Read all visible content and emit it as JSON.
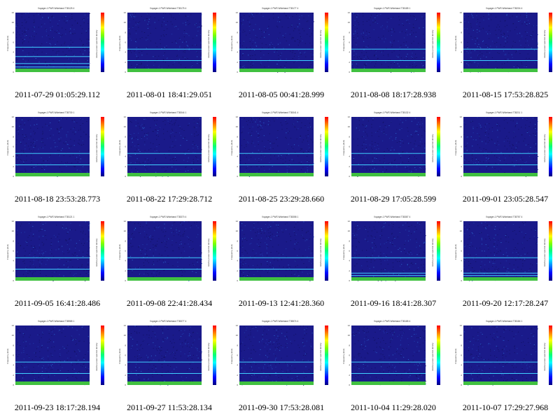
{
  "gallery": {
    "items": [
      {
        "caption": "2011-07-29 01:05:29.112",
        "plot_title": "Voyager-1 PWS Wideband T35125 4",
        "lines": [
          5.1,
          3.2,
          1.8,
          1.1
        ]
      },
      {
        "caption": "2011-08-01 18:41:29.051",
        "plot_title": "Voyager-1 PWS Wideband T35175 4",
        "lines": [
          4.7,
          2.4
        ]
      },
      {
        "caption": "2011-08-05 00:41:28.999",
        "plot_title": "Voyager-1 PWS Wideband T35177 4",
        "lines": [
          4.7,
          2.4
        ]
      },
      {
        "caption": "2011-08-08 18:17:28.938",
        "plot_title": "Voyager-1 PWS Wideband T35185 1",
        "lines": [
          4.7,
          2.4
        ]
      },
      {
        "caption": "2011-08-15 17:53:28.825",
        "plot_title": "Voyager-1 PWS Wideband T35204 4",
        "lines": [
          4.7,
          2.4
        ]
      },
      {
        "caption": "2011-08-18 23:53:28.773",
        "plot_title": "Voyager-1 PWS Wideband T35730 1",
        "lines": [
          4.7,
          2.4
        ]
      },
      {
        "caption": "2011-08-22 17:29:28.712",
        "plot_title": "Voyager-1 PWS Wideband T35344 1",
        "lines": [
          4.7,
          2.4
        ]
      },
      {
        "caption": "2011-08-25 23:29:28.660",
        "plot_title": "Voyager-1 PWS Wideband T35341 4",
        "lines": [
          4.7,
          2.4
        ]
      },
      {
        "caption": "2011-08-29 17:05:28.599",
        "plot_title": "Voyager-1 PWS Wideband T35132 4",
        "lines": [
          4.7,
          2.4
        ]
      },
      {
        "caption": "2011-09-01 23:05:28.547",
        "plot_title": "Voyager-1 PWS Wideband T35211 1",
        "lines": [
          4.7,
          2.4
        ]
      },
      {
        "caption": "2011-09-05 16:41:28.486",
        "plot_title": "Voyager-1 PWS Wideband T35121 1",
        "lines": [
          4.7,
          2.4
        ]
      },
      {
        "caption": "2011-09-08 22:41:28.434",
        "plot_title": "Voyager-1 PWS Wideband T35370 4",
        "lines": [
          4.7,
          2.4
        ]
      },
      {
        "caption": "2011-09-13 12:41:28.360",
        "plot_title": "Voyager-1 PWS Wideband T35358 1",
        "lines": [
          4.7,
          2.4
        ]
      },
      {
        "caption": "2011-09-16 18:41:28.307",
        "plot_title": "Voyager-1 PWS Wideband T35387 4",
        "lines": [
          4.7,
          1.6,
          1.1
        ]
      },
      {
        "caption": "2011-09-20 12:17:28.247",
        "plot_title": "Voyager-1 PWS Wideband T35757 4",
        "lines": [
          4.7,
          1.6,
          1.1
        ]
      },
      {
        "caption": "2011-09-23 18:17:28.194",
        "plot_title": "Voyager-1 PWS Wideband T35985 1",
        "lines": [
          4.7,
          2.4
        ]
      },
      {
        "caption": "2011-09-27 11:53:28.134",
        "plot_title": "Voyager-1 PWS Wideband T35377 4",
        "lines": [
          4.7,
          2.4
        ]
      },
      {
        "caption": "2011-09-30 17:53:28.081",
        "plot_title": "Voyager-1 PWS Wideband T35574 4",
        "lines": [
          4.7,
          2.4
        ]
      },
      {
        "caption": "2011-10-04 11:29:28.020",
        "plot_title": "Voyager-1 PWS Wideband T35185 4",
        "lines": [
          4.7,
          2.4
        ]
      },
      {
        "caption": "2011-10-07 17:29:27.968",
        "plot_title": "Voyager-1 PWS Wideband T35184 1",
        "lines": [
          4.7,
          2.4
        ]
      }
    ],
    "y_axis_label": "Frequency (kHz)",
    "y_ticks": [
      "0",
      "2",
      "4",
      "6",
      "8",
      "10",
      "12"
    ],
    "colorbar_label": "relative power spectral density",
    "colors": {
      "background": "#1a1a8a",
      "line": "#40d0ff",
      "band": "#40c040"
    }
  }
}
